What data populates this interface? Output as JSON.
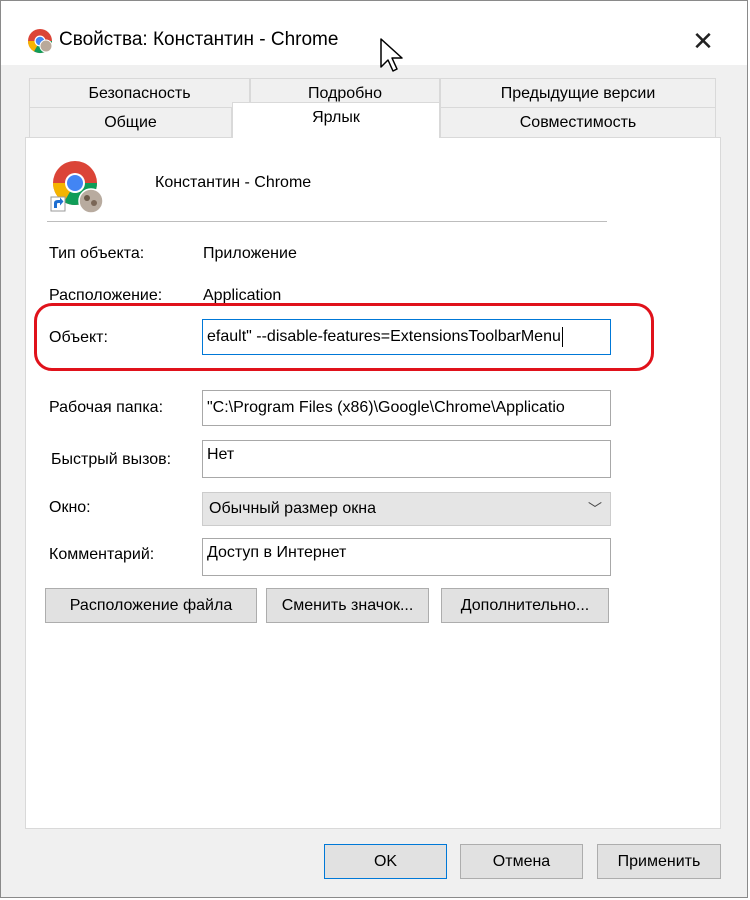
{
  "window": {
    "title": "Свойства: Константин - Chrome",
    "close_glyph": "✕"
  },
  "tabs": {
    "row1": [
      {
        "label": "Безопасность"
      },
      {
        "label": "Подробно"
      },
      {
        "label": "Предыдущие версии"
      }
    ],
    "row2": [
      {
        "label": "Общие"
      },
      {
        "label": "Ярлык",
        "active": true
      },
      {
        "label": "Совместимость"
      }
    ]
  },
  "shortcut": {
    "name": "Константин - Chrome"
  },
  "fields": {
    "object_type_label": "Тип объекта:",
    "object_type_value": "Приложение",
    "location_label": "Расположение:",
    "location_value": "Application",
    "target_label": "Объект:",
    "target_value": "efault\" --disable-features=ExtensionsToolbarMenu",
    "workdir_label": "Рабочая папка:",
    "workdir_value": "\"C:\\Program Files (x86)\\Google\\Chrome\\Applicatio",
    "hotkey_label": "Быстрый вызов:",
    "hotkey_value": "Нет",
    "window_label": "Окно:",
    "window_value": "Обычный размер окна",
    "comment_label": "Комментарий:",
    "comment_value": "Доступ в Интернет"
  },
  "actions": {
    "open_location": "Расположение файла",
    "change_icon": "Сменить значок...",
    "advanced": "Дополнительно..."
  },
  "footer": {
    "ok": "OK",
    "cancel": "Отмена",
    "apply": "Применить"
  },
  "colors": {
    "highlight": "#e0121b",
    "focus": "#0078d7"
  },
  "icons": {
    "app": "chrome-icon",
    "close": "close-icon",
    "dropdown": "chevron-down-icon",
    "shortcut": "shortcut-arrow-icon",
    "cursor": "mouse-pointer-icon"
  }
}
